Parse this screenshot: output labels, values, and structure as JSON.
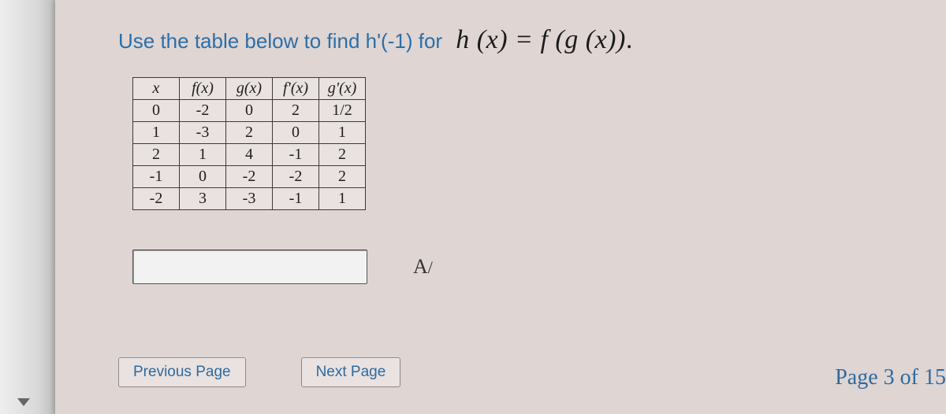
{
  "prompt": {
    "lead_text": "Use the table below to find h'(-1) for ",
    "formula_display": "h (x) = f (g (x))"
  },
  "table": {
    "headers": [
      "x",
      "f(x)",
      "g(x)",
      "f'(x)",
      "g'(x)"
    ],
    "rows": [
      [
        "0",
        "-2",
        "0",
        "2",
        "1/2"
      ],
      [
        "1",
        "-3",
        "2",
        "0",
        "1"
      ],
      [
        "2",
        "1",
        "4",
        "-1",
        "2"
      ],
      [
        "-1",
        "0",
        "-2",
        "-2",
        "2"
      ],
      [
        "-2",
        "3",
        "-3",
        "-1",
        "1"
      ]
    ]
  },
  "answer": {
    "value": ""
  },
  "nav": {
    "prev_label": "Previous Page",
    "next_label": "Next Page"
  },
  "page_indicator": "Page 3 of 15",
  "icons": {
    "font_tool": "A/"
  }
}
